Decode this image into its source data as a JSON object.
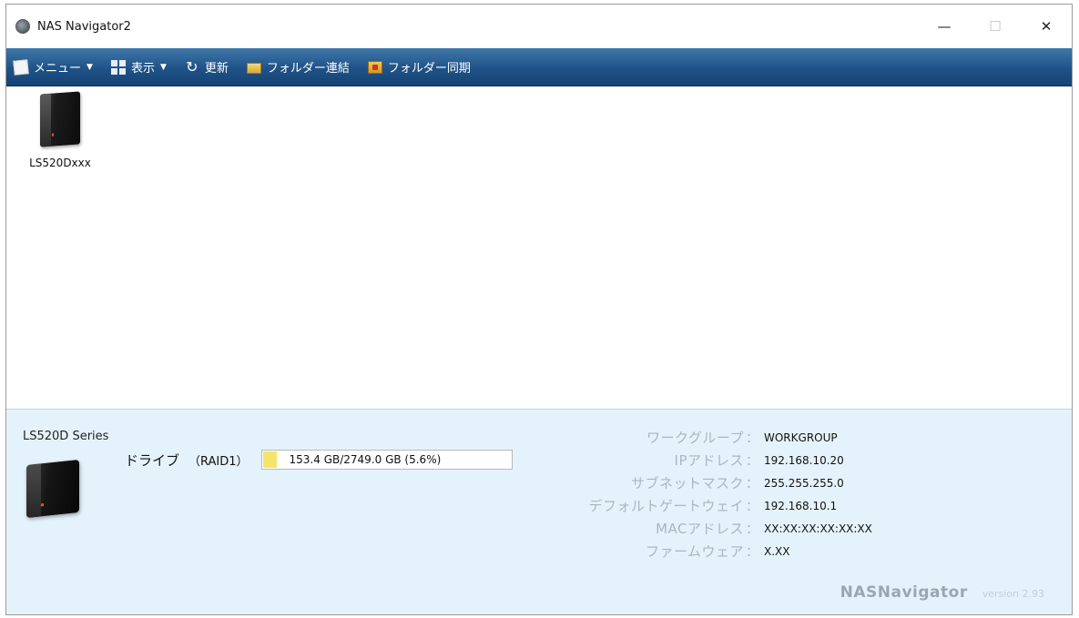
{
  "window": {
    "title": "NAS Navigator2",
    "controls": {
      "minimize": "—",
      "maximize": "☐",
      "close": "✕"
    }
  },
  "toolbar": {
    "menu_label": "メニュー",
    "view_label": "表示",
    "refresh_label": "更新",
    "folder_link_label": "フォルダー連結",
    "folder_sync_label": "フォルダー同期",
    "caret": "▼"
  },
  "devices": [
    {
      "name": "LS520Dxxx",
      "icon": "nas-device-icon"
    }
  ],
  "info": {
    "series": "LS520D Series",
    "drive": {
      "label": "ドライブ",
      "raid": "（RAID1）",
      "usage_text": "153.4 GB/2749.0 GB (5.6%)",
      "used_percent": 5.6,
      "bar_color": "#f4e46a"
    },
    "props": [
      {
        "key": "ワークグループ",
        "value": "WORKGROUP"
      },
      {
        "key": "IPアドレス",
        "value": "192.168.10.20"
      },
      {
        "key": "サブネットマスク",
        "value": "255.255.255.0"
      },
      {
        "key": "デフォルトゲートウェイ",
        "value": "192.168.10.1"
      },
      {
        "key": "MACアドレス",
        "value": "XX:XX:XX:XX:XX:XX"
      },
      {
        "key": "ファームウェア",
        "value": "X.XX"
      }
    ],
    "colon": "：",
    "brand": {
      "name": "NASNavigator",
      "version": "version 2.93"
    }
  },
  "colors": {
    "toolbar_top": "#3f77a9",
    "toolbar_bottom": "#154375",
    "info_panel_bg": "#e4f3fb"
  }
}
